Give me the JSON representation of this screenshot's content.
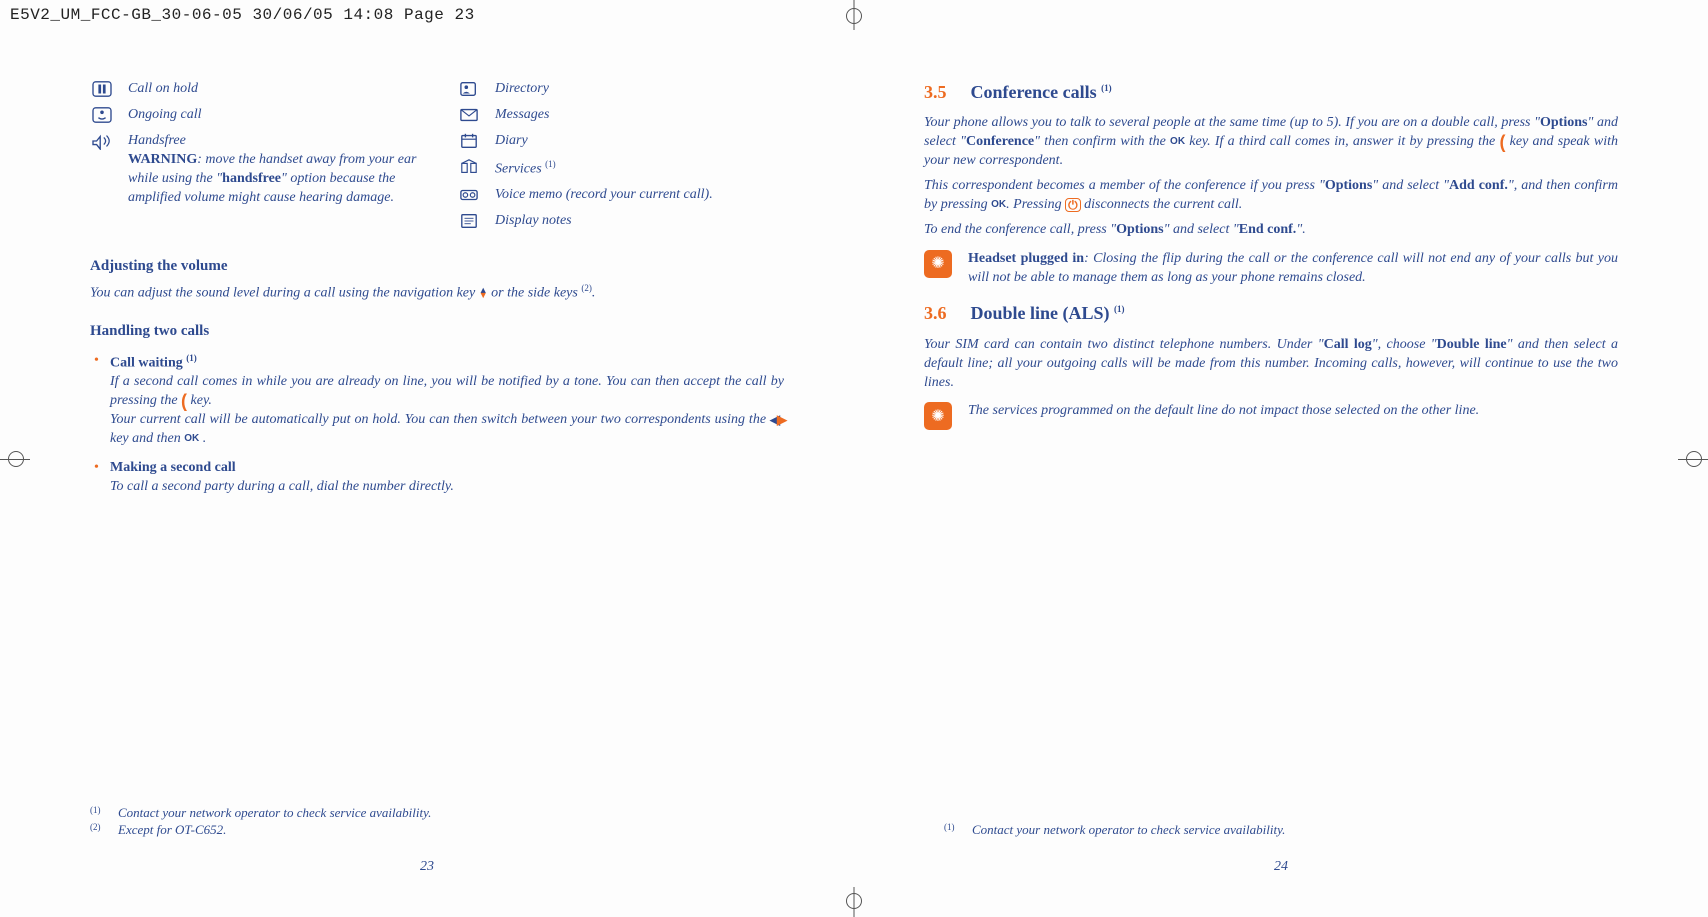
{
  "header": "E5V2_UM_FCC-GB_30-06-05  30/06/05  14:08  Page 23",
  "left": {
    "icons_col1": [
      {
        "glyph": "hold",
        "label": "Call on hold"
      },
      {
        "glyph": "ongoing",
        "label": "Ongoing call"
      },
      {
        "glyph": "handsfree",
        "label": "Handsfree",
        "warning_label": "WARNING",
        "warning_text": ": move the handset away from your ear while using the \"",
        "hf_word": "handsfree",
        "warning_text2": "\" option because the amplified volume might cause hearing damage."
      }
    ],
    "icons_col2": [
      {
        "glyph": "directory",
        "label": "Directory"
      },
      {
        "glyph": "messages",
        "label": "Messages"
      },
      {
        "glyph": "diary",
        "label": "Diary"
      },
      {
        "glyph": "services",
        "label": "Services ",
        "sup": "(1)"
      },
      {
        "glyph": "voicememo",
        "label": "Voice memo (record your current call)."
      },
      {
        "glyph": "notes",
        "label": "Display notes"
      }
    ],
    "adjust_heading": "Adjusting the volume",
    "adjust_body_a": "You can adjust the sound level during a call using the navigation key ",
    "adjust_body_b": " or the side keys ",
    "adjust_sup": "(2)",
    "adjust_body_c": ".",
    "handling_heading": "Handling two calls",
    "bullet1_title": "Call waiting ",
    "bullet1_sup": "(1)",
    "bullet1_body_a": "If a second call comes in while you are already on line, you will be notified by a tone. You can then accept the call by pressing the ",
    "bullet1_body_b": " key.",
    "bullet1_body_c": "Your current call will be automatically put on hold. You can then switch between your two correspondents using the ",
    "bullet1_body_d": " key and then ",
    "bullet1_body_e": ".",
    "bullet2_title": "Making a second call",
    "bullet2_body": "To call a second party during a call, dial the number directly.",
    "footnote1_mark": "(1)",
    "footnote1": "Contact your network operator to check service availability.",
    "footnote2_mark": "(2)",
    "footnote2": "Except for OT-C652.",
    "page_num": "23"
  },
  "right": {
    "sec35_num": "3.5",
    "sec35_title": "Conference calls ",
    "sec35_sup": "(1)",
    "p1_a": "Your phone allows you to talk to several people at the same time (up to 5). If you are on a double call, press \"",
    "p1_opt": "Options",
    "p1_b": "\" and select \"",
    "p1_conf": "Conference",
    "p1_c": "\" then confirm with the ",
    "p1_d": " key. If a third call comes in, answer it by pressing the ",
    "p1_e": " key and speak with your new correspondent.",
    "p2_a": "This correspondent becomes a member of the conference if you press \"",
    "p2_opt": "Options",
    "p2_b": "\" and select \"",
    "p2_add": "Add conf.",
    "p2_c": "\", and then confirm by pressing ",
    "p2_d": ". Pressing ",
    "p2_e": " disconnects the current call.",
    "p3_a": "To end the conference call, press \"",
    "p3_opt": "Options",
    "p3_b": "\" and select \"",
    "p3_end": "End conf.",
    "p3_c": "\".",
    "tip1_lead": "Headset plugged in",
    "tip1_body": ": Closing the flip during the call or the conference call will not end any of your calls but you will not be able to manage them as long as your phone remains closed.",
    "sec36_num": "3.6",
    "sec36_title": "Double line (ALS) ",
    "sec36_sup": "(1)",
    "p4_a": "Your SIM card can contain two distinct telephone numbers. Under \"",
    "p4_call": "Call log",
    "p4_b": "\", choose \"",
    "p4_dbl": "Double line",
    "p4_c": "\" and then select a default line; all your outgoing calls will be made from this number. Incoming calls, however, will continue to use the two lines.",
    "tip2_body": "The services programmed on the default line do not impact those selected on the other line.",
    "footnote1_mark": "(1)",
    "footnote1": "Contact your network operator to check service availability.",
    "page_num": "24"
  }
}
